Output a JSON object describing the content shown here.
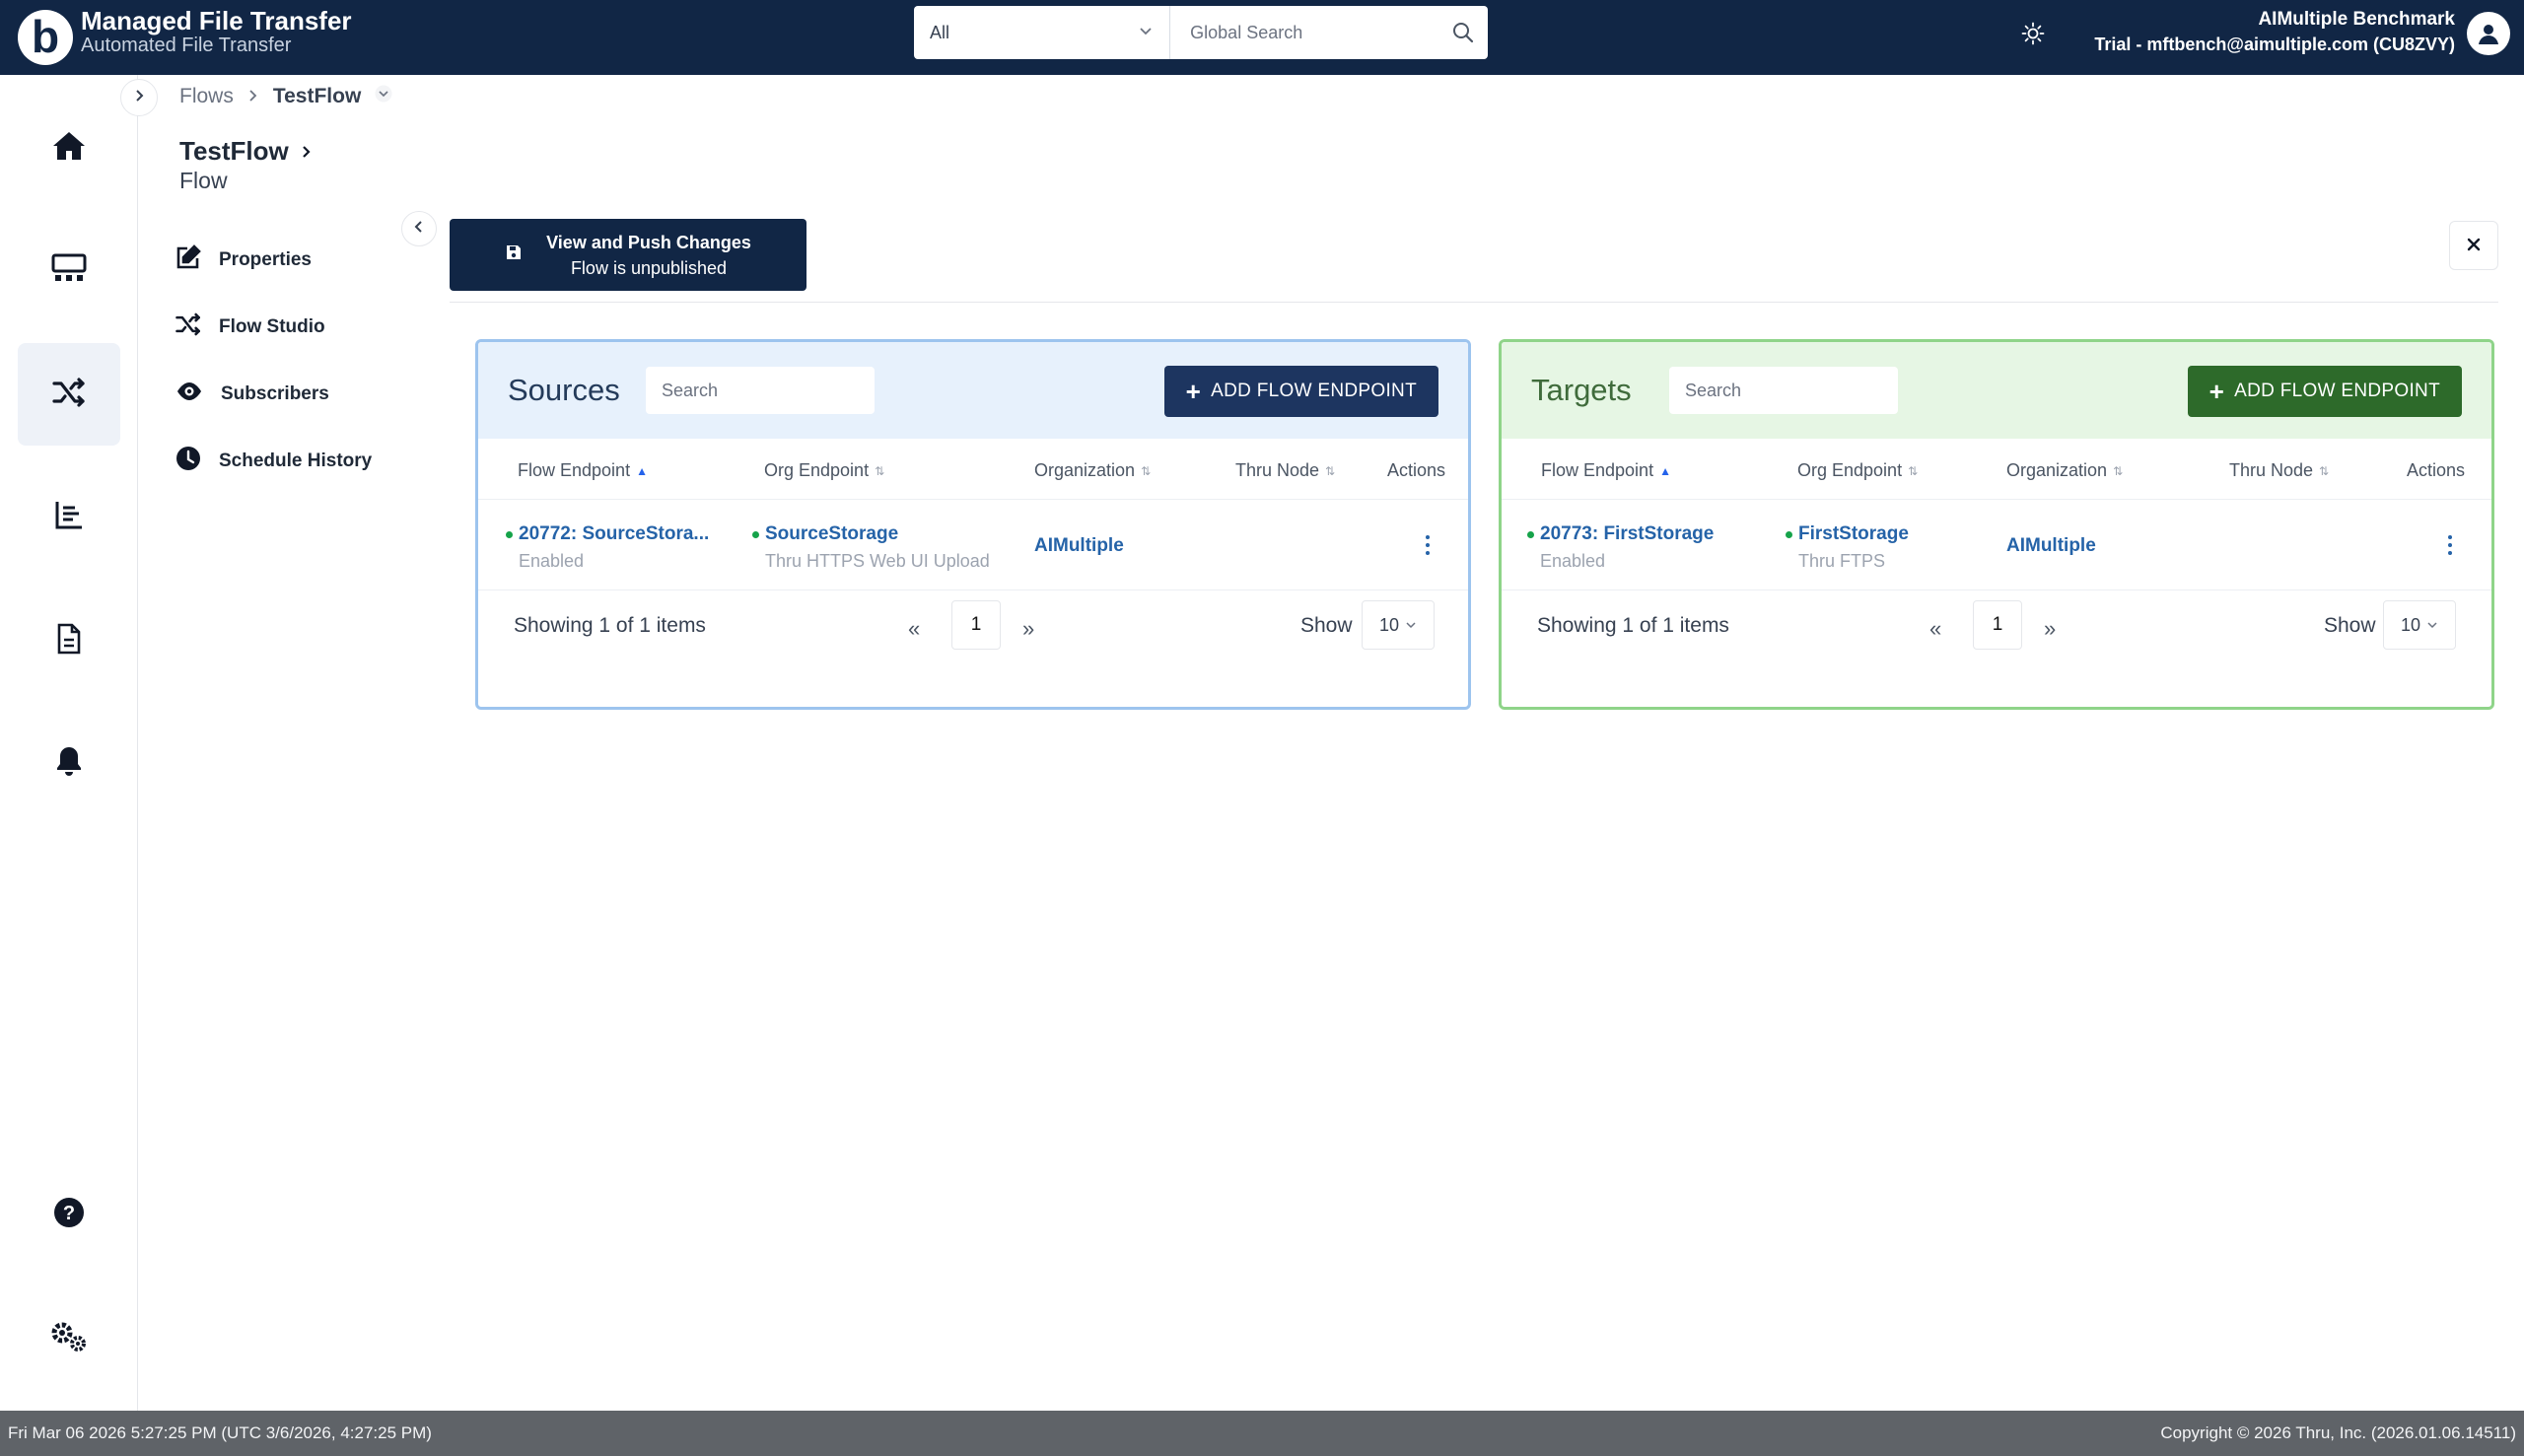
{
  "app": {
    "logo_letter": "b",
    "title": "Managed File Transfer",
    "subtitle": "Automated File Transfer"
  },
  "search": {
    "scope": "All",
    "placeholder": "Global Search"
  },
  "user": {
    "name": "AIMultiple Benchmark",
    "account": "Trial - mftbench@aimultiple.com (CU8ZVY)"
  },
  "breadcrumb": {
    "parent": "Flows",
    "current": "TestFlow"
  },
  "page": {
    "title": "TestFlow",
    "subtitle": "Flow"
  },
  "side_menu": {
    "items": [
      {
        "label": "Properties",
        "icon": "edit-icon"
      },
      {
        "label": "Flow Studio",
        "icon": "shuffle-icon"
      },
      {
        "label": "Subscribers",
        "icon": "eye-icon"
      },
      {
        "label": "Schedule History",
        "icon": "clock-icon"
      }
    ]
  },
  "push": {
    "label": "View and Push Changes",
    "status": "Flow is unpublished"
  },
  "sources": {
    "title": "Sources",
    "search_placeholder": "Search",
    "add_label": "ADD FLOW ENDPOINT",
    "columns": [
      "Flow Endpoint",
      "Org Endpoint",
      "Organization",
      "Thru Node",
      "Actions"
    ],
    "rows": [
      {
        "flow_endpoint": "20772: SourceStora...",
        "flow_status": "Enabled",
        "org_endpoint": "SourceStorage",
        "org_endpoint_sub": "Thru HTTPS Web UI Upload",
        "organization": "AIMultiple",
        "thru_node": ""
      }
    ],
    "pagination": {
      "showing": "Showing 1 of 1 items",
      "page": "1",
      "show_label": "Show",
      "page_size": "10"
    }
  },
  "targets": {
    "title": "Targets",
    "search_placeholder": "Search",
    "add_label": "ADD FLOW ENDPOINT",
    "columns": [
      "Flow Endpoint",
      "Org Endpoint",
      "Organization",
      "Thru Node",
      "Actions"
    ],
    "rows": [
      {
        "flow_endpoint": "20773: FirstStorage",
        "flow_status": "Enabled",
        "org_endpoint": "FirstStorage",
        "org_endpoint_sub": "Thru FTPS",
        "organization": "AIMultiple",
        "thru_node": ""
      }
    ],
    "pagination": {
      "showing": "Showing 1 of 1 items",
      "page": "1",
      "show_label": "Show",
      "page_size": "10"
    }
  },
  "footer": {
    "datetime": "Fri Mar 06 2026 5:27:25 PM (UTC 3/6/2026, 4:27:25 PM)",
    "copyright": "Copyright © 2026 Thru, Inc. (2026.01.06.14511)"
  },
  "colors": {
    "header_bg": "#112645",
    "sources_accent": "#1d3560",
    "targets_accent": "#2d6a2a",
    "link": "#2563a8",
    "status_enabled": "#16a34a"
  }
}
